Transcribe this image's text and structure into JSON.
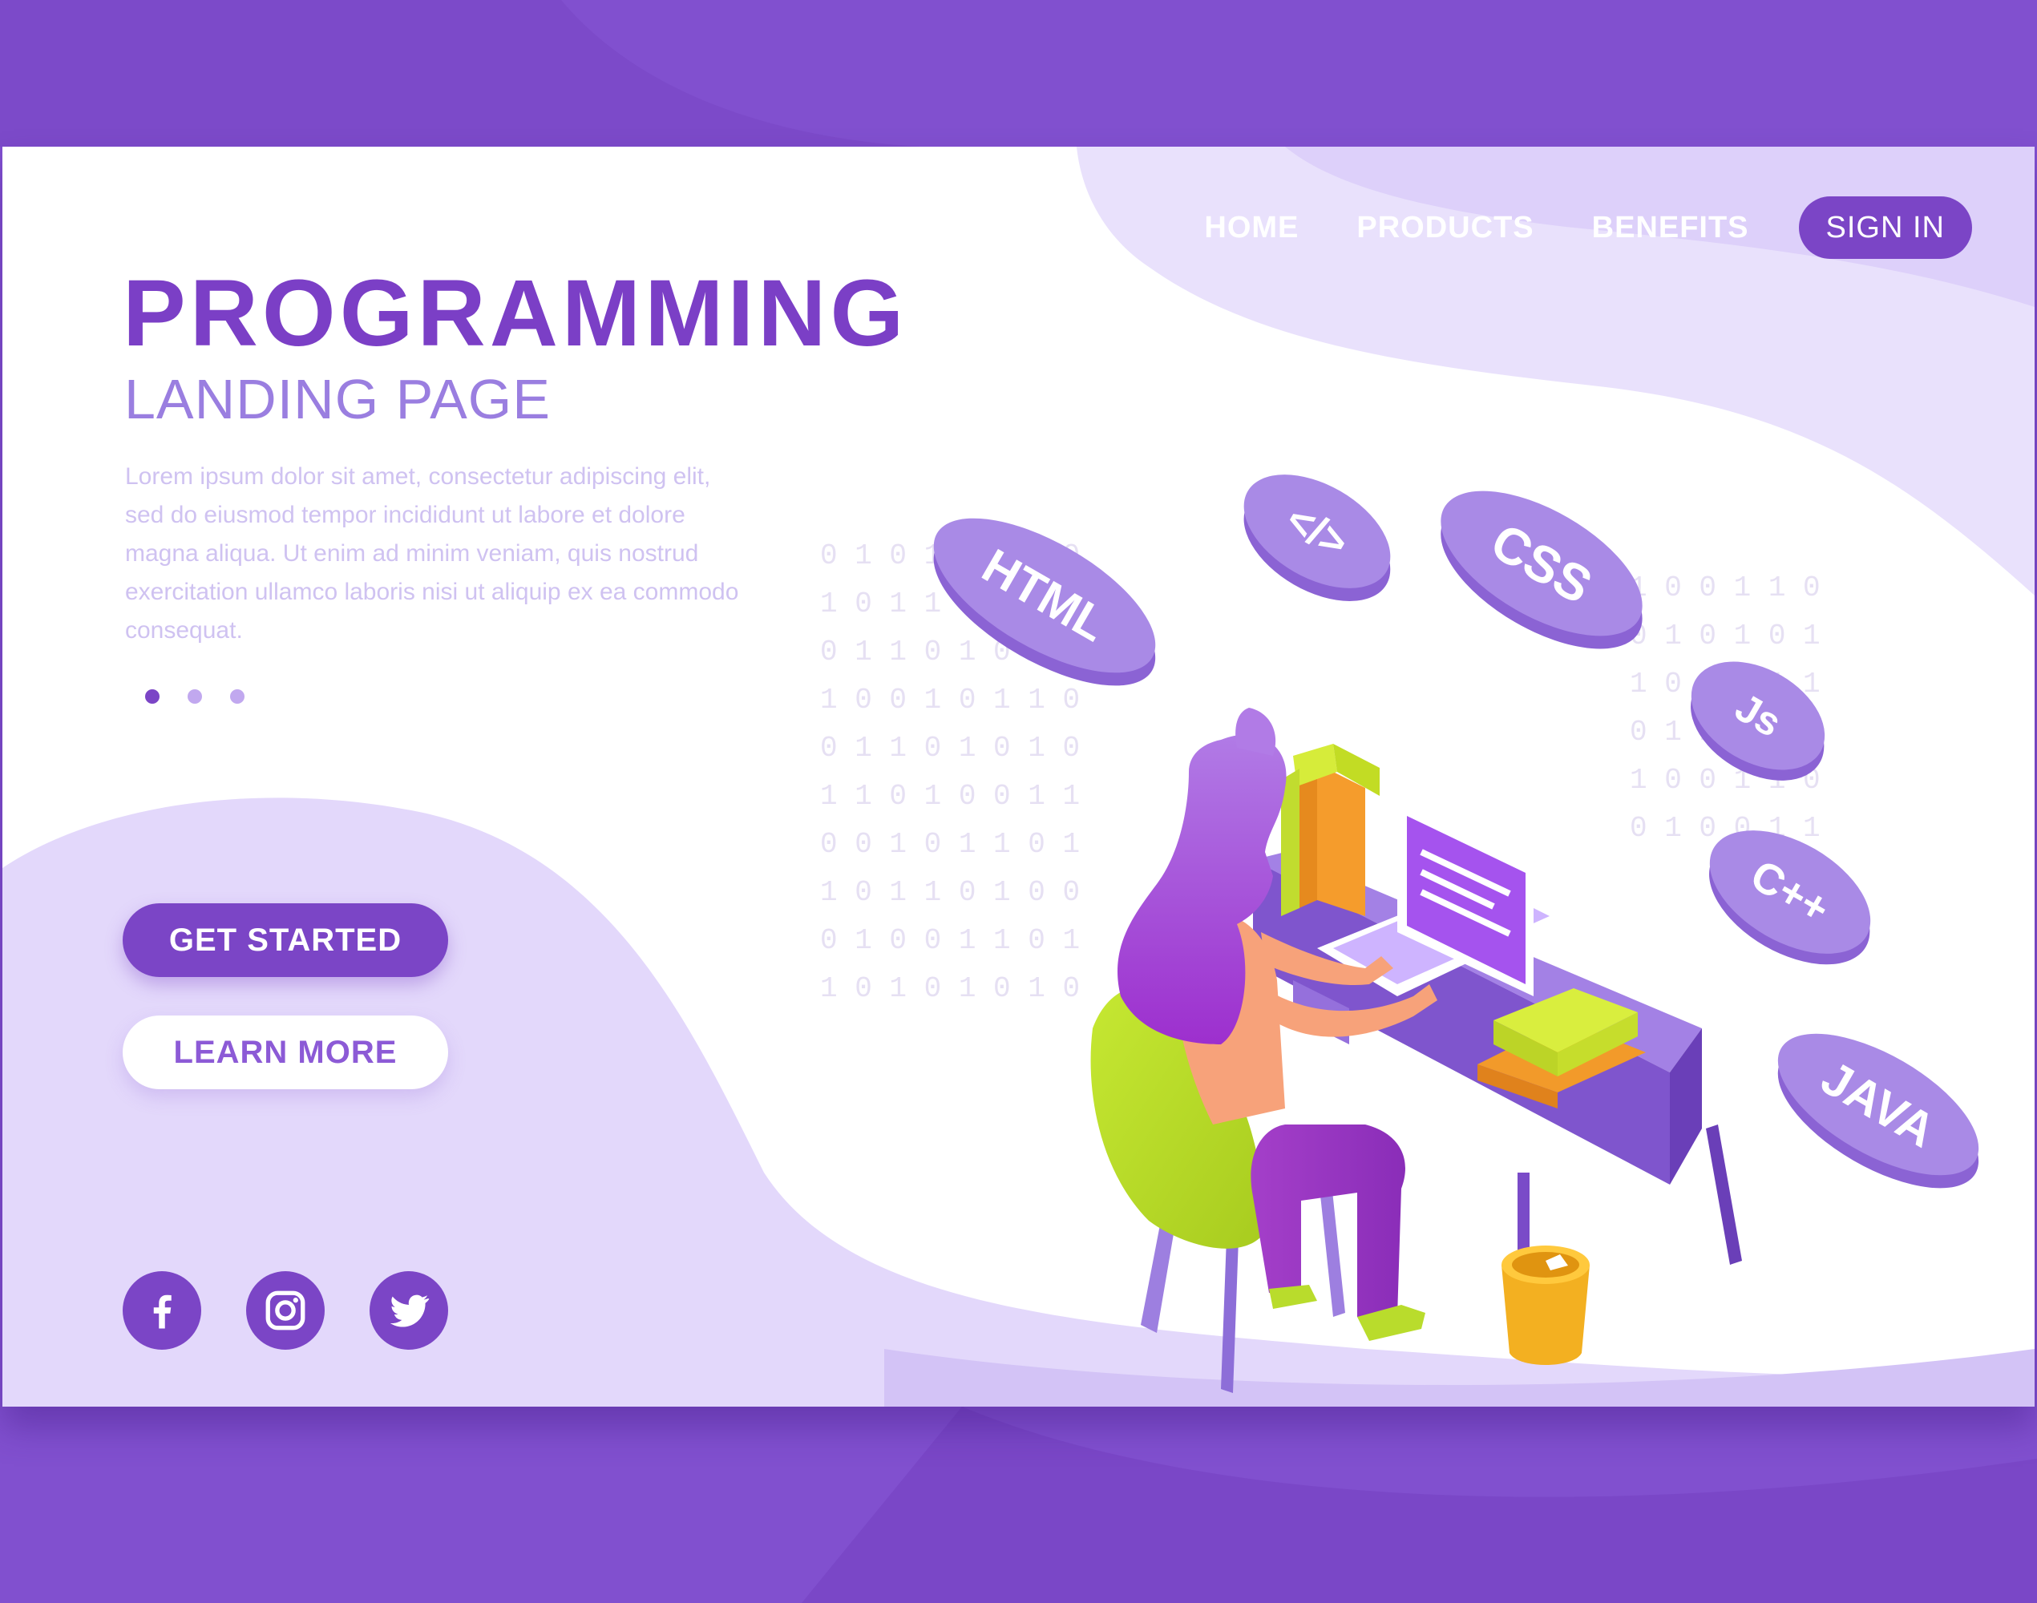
{
  "nav": {
    "items": [
      {
        "label": "HOME"
      },
      {
        "label": "PRODUCTS"
      },
      {
        "label": "BENEFITS"
      }
    ],
    "sign_in_label": "SIGN IN"
  },
  "hero": {
    "title": "PROGRAMMING",
    "subtitle": "LANDING PAGE",
    "description": "Lorem ipsum dolor sit amet, consectetur adipiscing elit, sed do eiusmod tempor incididunt ut labore et dolore magna aliqua. Ut enim ad minim veniam, quis nostrud exercitation ullamco laboris nisi ut aliquip ex ea commodo consequat.",
    "slides": {
      "count": 3,
      "active": 1
    },
    "get_started_label": "GET STARTED",
    "learn_more_label": "LEARN MORE"
  },
  "social": [
    {
      "icon": "facebook-icon"
    },
    {
      "icon": "instagram-icon"
    },
    {
      "icon": "twitter-icon"
    }
  ],
  "illustration": {
    "pills": [
      {
        "label": "HTML"
      },
      {
        "label": "</>"
      },
      {
        "label": "CSS"
      },
      {
        "label": "Js"
      },
      {
        "label": "C++"
      },
      {
        "label": "JAVA"
      }
    ]
  },
  "colors": {
    "primary": "#7b45c6",
    "outer_background": "#8150cf",
    "title": "#7b3fc6",
    "subtitle": "#9a7ee0",
    "lavender_light": "#e6dcfb",
    "pill": "#a98ae6"
  }
}
